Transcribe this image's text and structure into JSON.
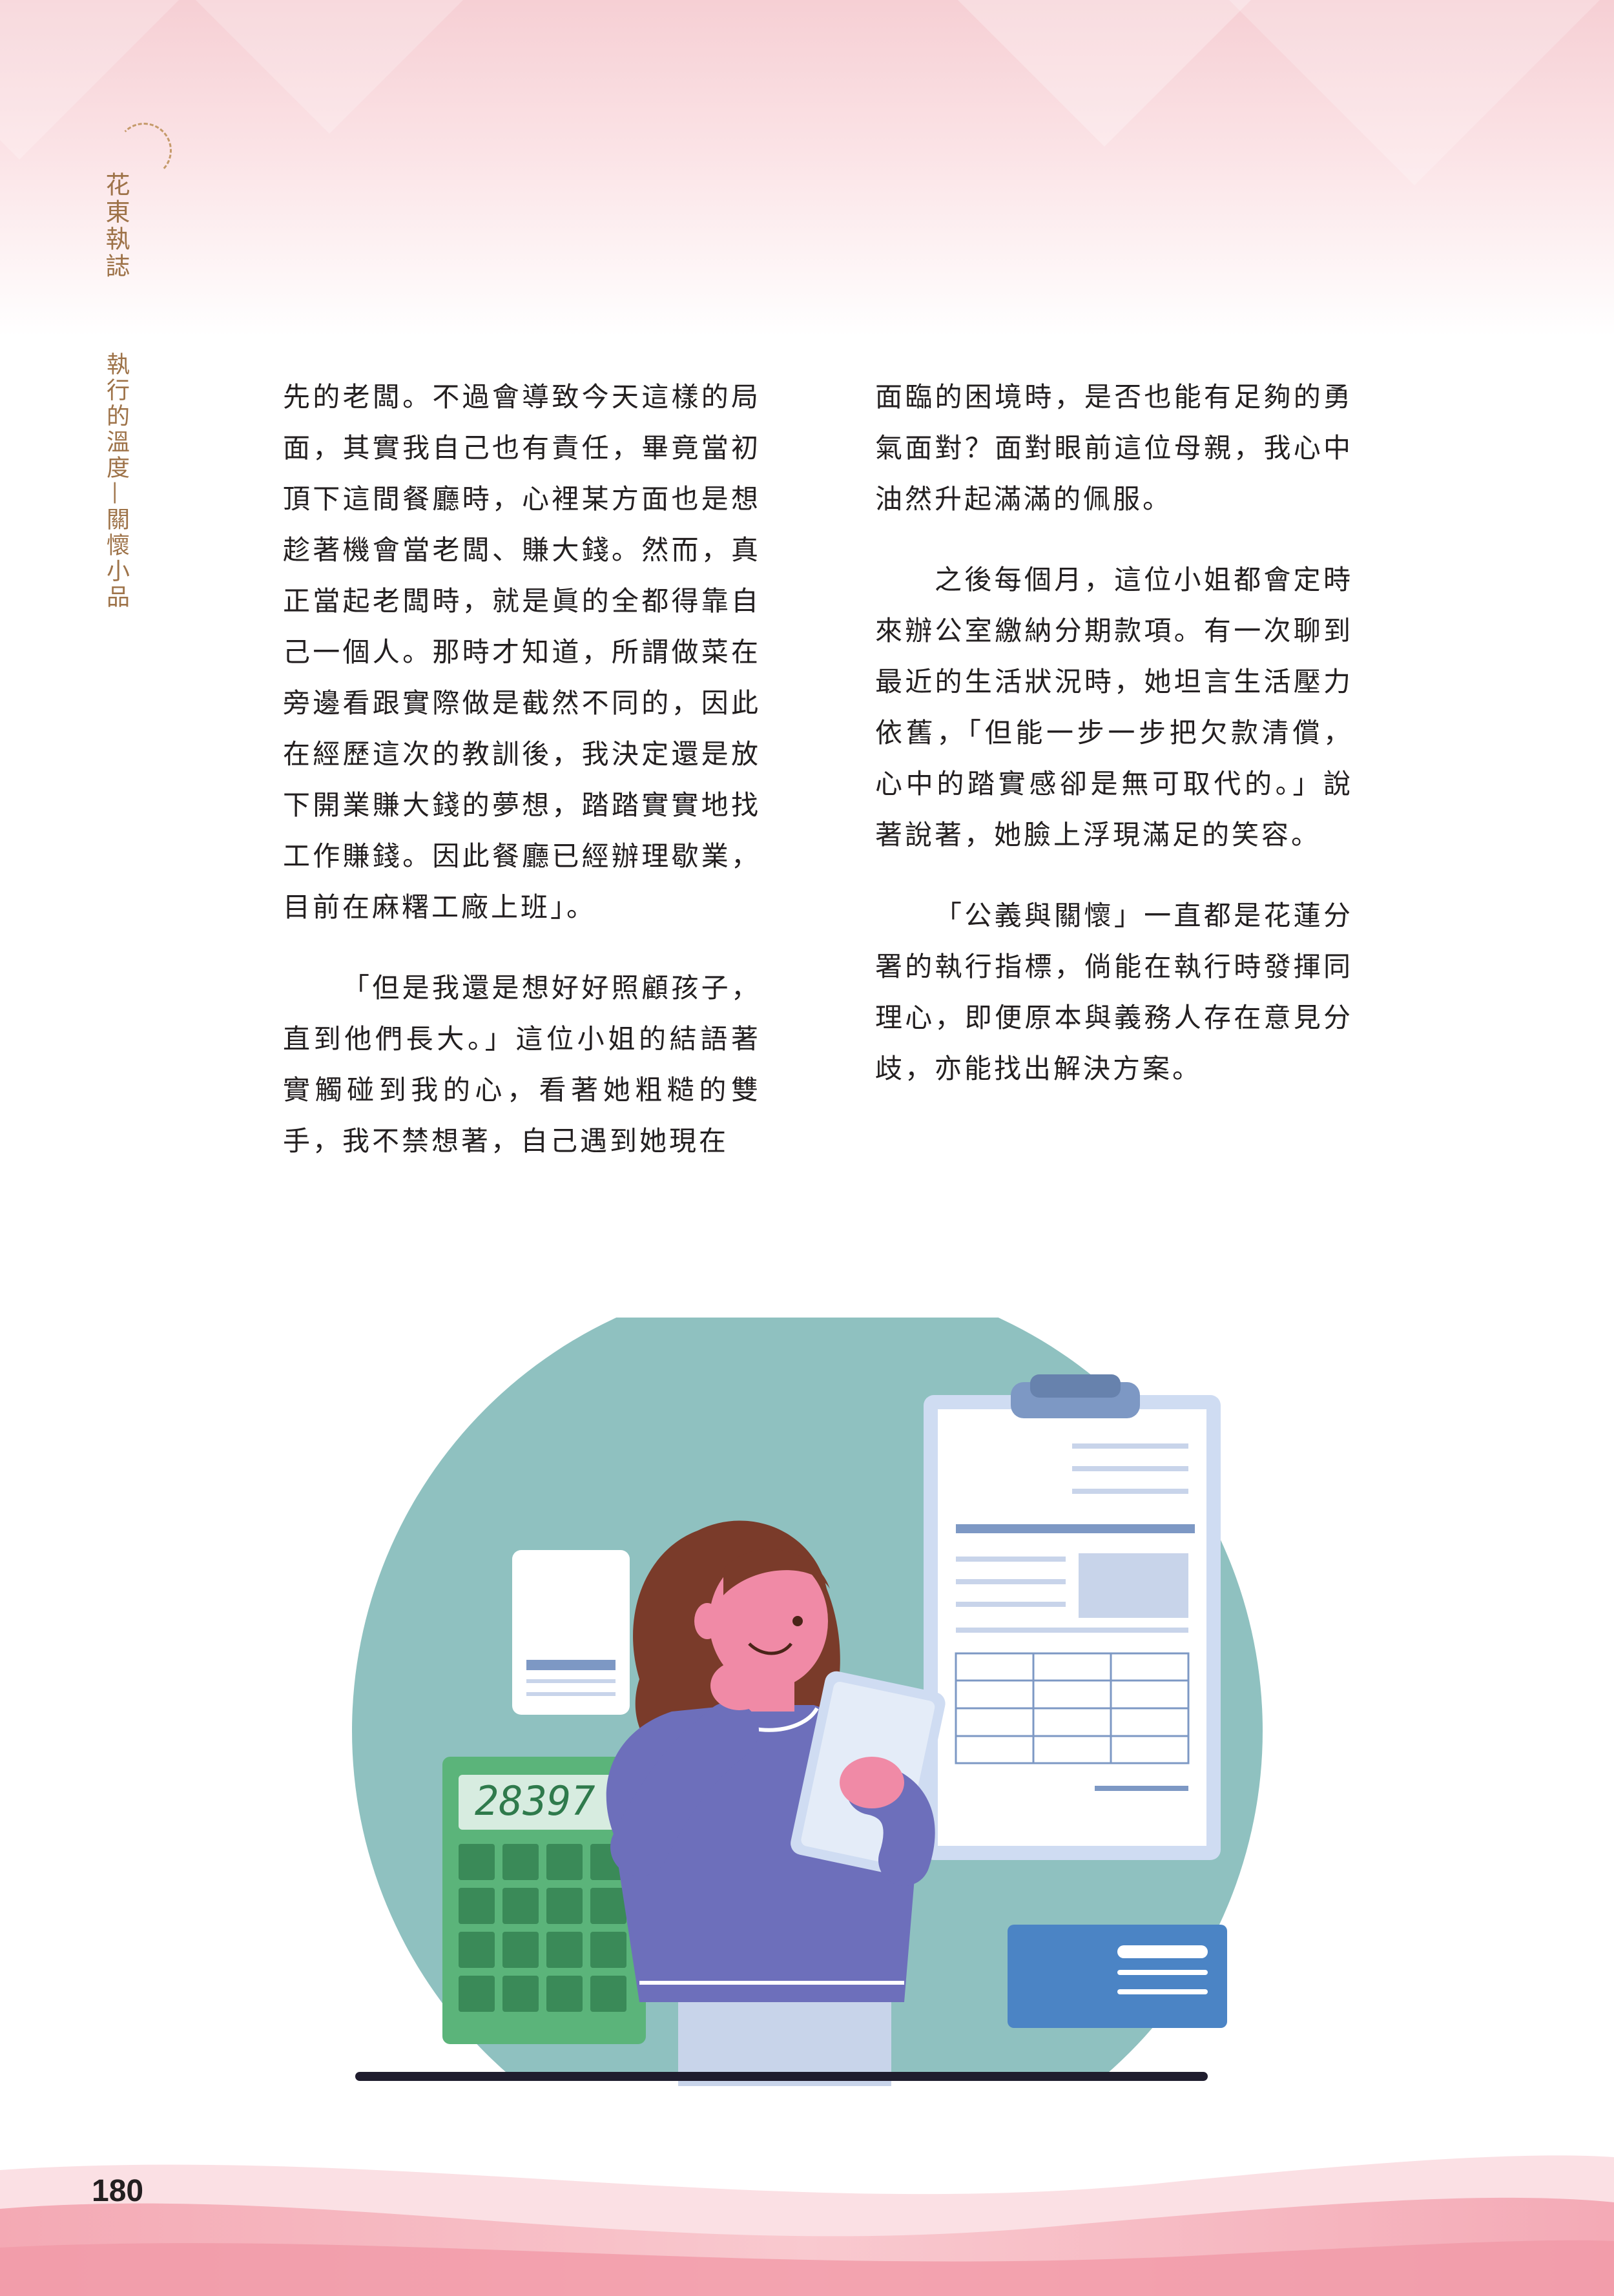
{
  "header": {
    "section_title": "花東執誌",
    "subtitle": "執行的溫度—關懷小品"
  },
  "article": {
    "left_paragraphs": [
      "先的老闆。不過會導致今天這樣的局面，其實我自己也有責任，畢竟當初頂下這間餐廳時，心裡某方面也是想趁著機會當老闆、賺大錢。然而，真正當起老闆時，就是眞的全都得靠自己一個人。那時才知道，所謂做菜在旁邊看跟實際做是截然不同的，因此在經歷這次的教訓後，我決定還是放下開業賺大錢的夢想，踏踏實實地找工作賺錢。因此餐廳已經辦理歇業，目前在麻糬工廠上班」。",
      "「但是我還是想好好照顧孩子，直到他們長大。」這位小姐的結語著實觸碰到我的心，看著她粗糙的雙手，我不禁想著，自己遇到她現在"
    ],
    "right_paragraphs": [
      "面臨的困境時，是否也能有足夠的勇氣面對？面對眼前這位母親，我心中油然升起滿滿的佩服。",
      "之後每個月，這位小姐都會定時來辦公室繳納分期款項。有一次聊到最近的生活狀況時，她坦言生活壓力依舊，「但能一步一步把欠款清償，心中的踏實感卻是無可取代的。」說著說著，她臉上浮現滿足的笑容。",
      "「公義與關懷」一直都是花蓮分署的執行指標，倘能在執行時發揮同理心，即便原本與義務人存在意見分歧，亦能找出解決方案。"
    ]
  },
  "illustration": {
    "calculator_display": "28397"
  },
  "footer": {
    "page_number": "180"
  },
  "colors": {
    "accent_brown": "#9e7349",
    "teal_circle": "#8fc1c0",
    "calculator_green": "#5bb47a",
    "sweater_purple": "#6d6fbb",
    "hair_brown": "#7a3b2a",
    "skin_pink": "#f08aa6",
    "clipboard_blue": "#cfdcf2"
  }
}
